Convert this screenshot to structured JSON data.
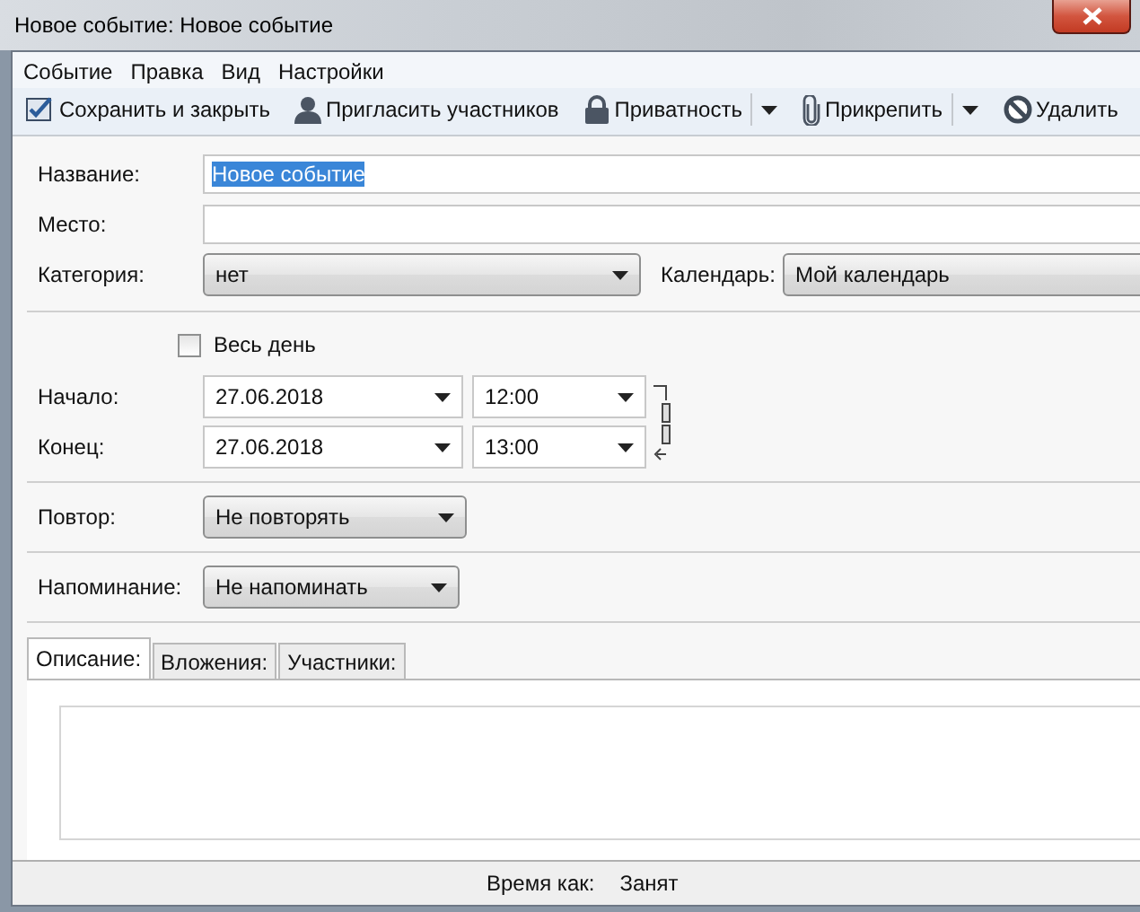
{
  "window": {
    "title": "Новое событие: Новое событие"
  },
  "menu": [
    "Событие",
    "Правка",
    "Вид",
    "Настройки"
  ],
  "toolbar": [
    {
      "label": "Сохранить и закрыть",
      "kind": "save",
      "dropdown": false
    },
    {
      "label": "Пригласить участников",
      "kind": "invite",
      "dropdown": false
    },
    {
      "label": "Приватность",
      "kind": "privacy",
      "dropdown": true
    },
    {
      "label": "Прикрепить",
      "kind": "attach",
      "dropdown": true
    },
    {
      "label": "Удалить",
      "kind": "delete",
      "dropdown": false
    }
  ],
  "form": {
    "title": {
      "label": "Название:",
      "value": "Новое событие",
      "text_selected": true
    },
    "location": {
      "label": "Место:"
    },
    "category": {
      "label": "Категория:",
      "value": "нет"
    },
    "calendar": {
      "label": "Календарь:",
      "value": "Мой календарь"
    },
    "all_day": {
      "label": "Весь день",
      "checked": false
    },
    "start": {
      "label": "Начало:",
      "date": "27.06.2018",
      "time": "12:00"
    },
    "end": {
      "label": "Конец:",
      "date": "27.06.2018",
      "time": "13:00"
    },
    "repeat": {
      "label": "Повтор:",
      "value": "Не повторять"
    },
    "reminder": {
      "label": "Напоминание:",
      "value": "Не напоминать"
    }
  },
  "tabs": [
    {
      "label": "Описание:",
      "selected": true
    },
    {
      "label": "Вложения:",
      "selected": false
    },
    {
      "label": "Участники:",
      "selected": false
    }
  ],
  "status_bar": {
    "label": "Время как:",
    "value": "Занят"
  }
}
